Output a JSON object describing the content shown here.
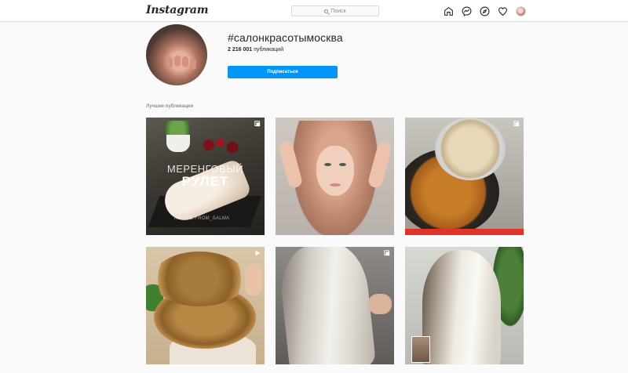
{
  "nav": {
    "logo": "Instagram",
    "search_placeholder": "Поиск",
    "icons": [
      "home-icon",
      "messenger-icon",
      "explore-icon",
      "heart-icon",
      "profile-avatar"
    ]
  },
  "header": {
    "hashtag": "#салонкрасотымосква",
    "posts_count": "2 216 001",
    "posts_label": "публикаций",
    "follow_label": "Подписаться"
  },
  "top_posts": {
    "label": "Лучшие публикации",
    "tiles": [
      {
        "type": "carousel",
        "overlay_line1": "МЕРЕНГОВЫЙ",
        "overlay_line2": "РУЛЕТ",
        "credit": "RECIPE.FROM_SALMA"
      },
      {
        "type": "photo"
      },
      {
        "type": "carousel"
      },
      {
        "type": "video"
      },
      {
        "type": "carousel"
      },
      {
        "type": "photo"
      }
    ]
  },
  "colors": {
    "accent": "#0095f6",
    "text": "#262626",
    "muted": "#8e8e8e",
    "background": "#fafafa",
    "border": "#dbdbdb"
  }
}
